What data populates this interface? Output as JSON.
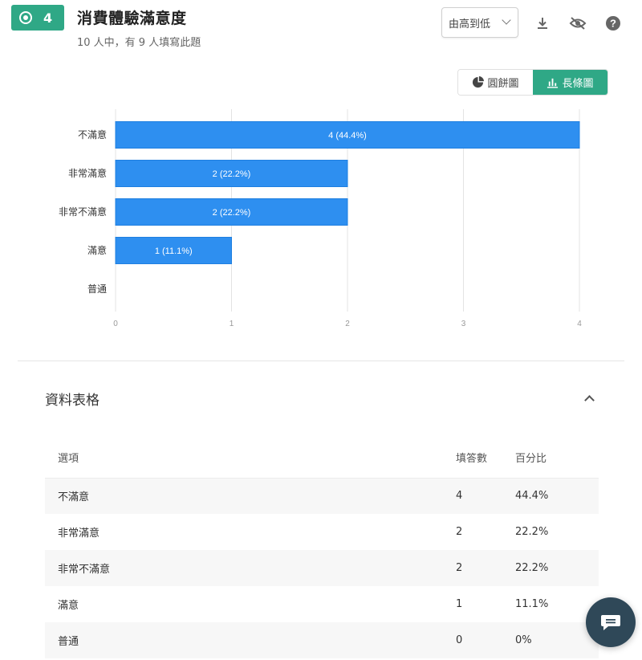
{
  "question": {
    "number": "4",
    "title": "消費體驗滿意度",
    "subtitle": "10 人中，有 9 人填寫此題"
  },
  "toolbar": {
    "sort_label": "由高到低",
    "icons": [
      "download-icon",
      "eye-off-icon",
      "help-icon"
    ]
  },
  "view_toggle": {
    "pie_label": "圓餅圖",
    "bar_label": "長條圖",
    "active": "bar"
  },
  "colors": {
    "accent": "#2fa886",
    "bar": "#2e8ff0",
    "chat": "#2f4858"
  },
  "chart_data": {
    "type": "bar",
    "orientation": "horizontal",
    "categories": [
      "不滿意",
      "非常滿意",
      "非常不滿意",
      "滿意",
      "普通"
    ],
    "values": [
      4,
      2,
      2,
      1,
      0
    ],
    "data_labels": [
      "4 (44.4%)",
      "2 (22.2%)",
      "2 (22.2%)",
      "1 (11.1%)",
      ""
    ],
    "xlim": [
      0,
      4
    ],
    "xticks": [
      "0",
      "1",
      "2",
      "3",
      "4"
    ],
    "grid": "vertical"
  },
  "table": {
    "section_title": "資料表格",
    "headers": [
      "選項",
      "填答數",
      "百分比"
    ],
    "rows": [
      [
        "不滿意",
        "4",
        "44.4%"
      ],
      [
        "非常滿意",
        "2",
        "22.2%"
      ],
      [
        "非常不滿意",
        "2",
        "22.2%"
      ],
      [
        "滿意",
        "1",
        "11.1%"
      ],
      [
        "普通",
        "0",
        "0%"
      ]
    ]
  }
}
